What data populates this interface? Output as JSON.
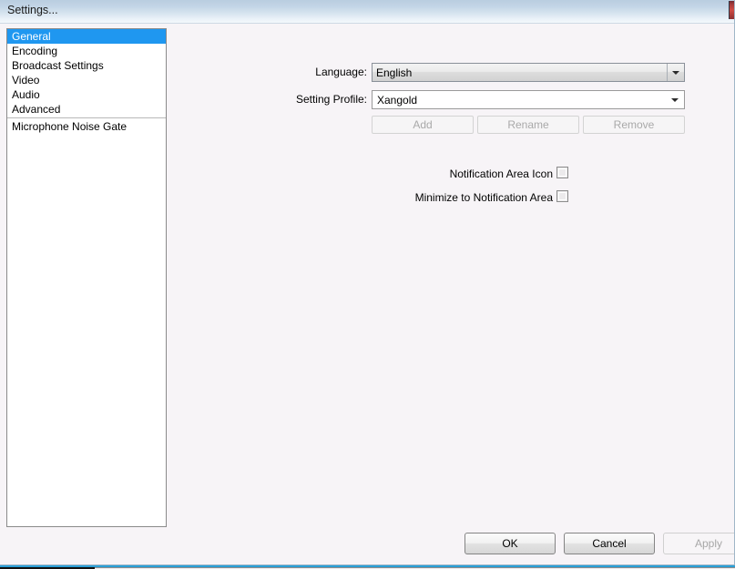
{
  "window": {
    "title": "Settings...",
    "close_icon": "close-icon"
  },
  "sidebar": {
    "items": [
      {
        "label": "General",
        "selected": true
      },
      {
        "label": "Encoding",
        "selected": false
      },
      {
        "label": "Broadcast Settings",
        "selected": false
      },
      {
        "label": "Video",
        "selected": false
      },
      {
        "label": "Audio",
        "selected": false
      },
      {
        "label": "Advanced",
        "selected": false
      }
    ],
    "separated_items": [
      {
        "label": "Microphone Noise Gate",
        "selected": false
      }
    ]
  },
  "main": {
    "language": {
      "label": "Language:",
      "value": "English",
      "arrow_icon": "chevron-down-icon"
    },
    "setting_profile": {
      "label": "Setting Profile:",
      "value": "Xangold",
      "arrow_icon": "chevron-down-icon"
    },
    "profile_buttons": [
      {
        "label": "Add",
        "enabled": false
      },
      {
        "label": "Rename",
        "enabled": false
      },
      {
        "label": "Remove",
        "enabled": false
      }
    ],
    "checkboxes": [
      {
        "label": "Notification Area Icon",
        "checked": false
      },
      {
        "label": "Minimize to Notification Area",
        "checked": false
      }
    ]
  },
  "dialog_buttons": [
    {
      "label": "OK",
      "enabled": true
    },
    {
      "label": "Cancel",
      "enabled": true
    },
    {
      "label": "Apply",
      "enabled": false
    }
  ],
  "colors": {
    "selection": "#1f97f0",
    "background": "#f7f4f7",
    "titlebar_top": "#b9cde0",
    "close_button": "#cf4b44",
    "behind_accent": "#2a9fd6"
  }
}
